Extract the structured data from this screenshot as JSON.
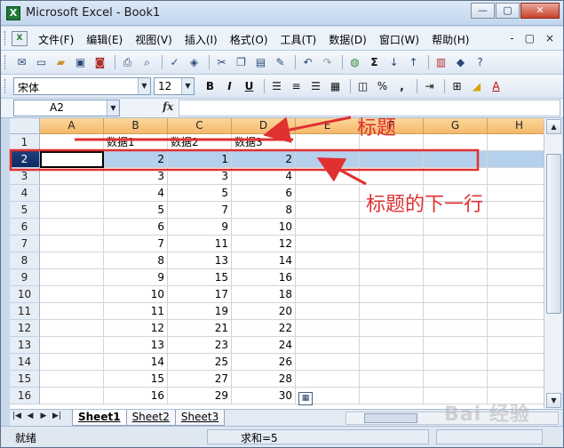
{
  "window": {
    "title": "Microsoft Excel - Book1",
    "buttons": {
      "minimize": "—",
      "restore": "▢",
      "close": "✕"
    }
  },
  "menubar": {
    "items": [
      "文件(F)",
      "编辑(E)",
      "视图(V)",
      "插入(I)",
      "格式(O)",
      "工具(T)",
      "数据(D)",
      "窗口(W)",
      "帮助(H)"
    ],
    "right_controls": [
      "-",
      "▢",
      "×"
    ]
  },
  "toolbar_standard": {
    "icons": [
      "mail-icon",
      "new-icon",
      "open-icon",
      "save-icon",
      "permission-icon",
      "print-icon",
      "print-preview-icon",
      "spelling-icon",
      "research-icon",
      "cut-icon",
      "copy-icon",
      "paste-icon",
      "format-painter-icon",
      "undo-icon",
      "redo-icon",
      "hyperlink-icon",
      "autosum-icon",
      "sort-asc-icon",
      "sort-desc-icon",
      "chart-icon",
      "drawing-icon",
      "help-icon"
    ]
  },
  "toolbar_format": {
    "font": "宋体",
    "size": "12",
    "bold": "B",
    "italic": "I",
    "underline": "U",
    "percent": "%",
    "comma": ","
  },
  "formula_bar": {
    "name_box": "A2",
    "fx": "fx",
    "value": ""
  },
  "grid": {
    "columns": [
      "A",
      "B",
      "C",
      "D",
      "E",
      "F",
      "G",
      "H"
    ],
    "rows": [
      {
        "num": "1",
        "cells": [
          "",
          "数据1",
          "数据2",
          "数据3",
          "",
          "",
          "",
          ""
        ]
      },
      {
        "num": "2",
        "cells": [
          "",
          "2",
          "1",
          "2",
          "",
          "",
          "",
          ""
        ]
      },
      {
        "num": "3",
        "cells": [
          "",
          "3",
          "3",
          "4",
          "",
          "",
          "",
          ""
        ]
      },
      {
        "num": "4",
        "cells": [
          "",
          "4",
          "5",
          "6",
          "",
          "",
          "",
          ""
        ]
      },
      {
        "num": "5",
        "cells": [
          "",
          "5",
          "7",
          "8",
          "",
          "",
          "",
          ""
        ]
      },
      {
        "num": "6",
        "cells": [
          "",
          "6",
          "9",
          "10",
          "",
          "",
          "",
          ""
        ]
      },
      {
        "num": "7",
        "cells": [
          "",
          "7",
          "11",
          "12",
          "",
          "",
          "",
          ""
        ]
      },
      {
        "num": "8",
        "cells": [
          "",
          "8",
          "13",
          "14",
          "",
          "",
          "",
          ""
        ]
      },
      {
        "num": "9",
        "cells": [
          "",
          "9",
          "15",
          "16",
          "",
          "",
          "",
          ""
        ]
      },
      {
        "num": "10",
        "cells": [
          "",
          "10",
          "17",
          "18",
          "",
          "",
          "",
          ""
        ]
      },
      {
        "num": "11",
        "cells": [
          "",
          "11",
          "19",
          "20",
          "",
          "",
          "",
          ""
        ]
      },
      {
        "num": "12",
        "cells": [
          "",
          "12",
          "21",
          "22",
          "",
          "",
          "",
          ""
        ]
      },
      {
        "num": "13",
        "cells": [
          "",
          "13",
          "23",
          "24",
          "",
          "",
          "",
          ""
        ]
      },
      {
        "num": "14",
        "cells": [
          "",
          "14",
          "25",
          "26",
          "",
          "",
          "",
          ""
        ]
      },
      {
        "num": "15",
        "cells": [
          "",
          "15",
          "27",
          "28",
          "",
          "",
          "",
          ""
        ]
      },
      {
        "num": "16",
        "cells": [
          "",
          "16",
          "29",
          "30",
          "",
          "",
          "",
          ""
        ]
      }
    ]
  },
  "sheets": [
    "Sheet1",
    "Sheet2",
    "Sheet3"
  ],
  "status": {
    "ready": "就绪",
    "sum": "求和=5"
  },
  "annotations": {
    "header_label": "标题",
    "next_row_label": "标题的下一行"
  },
  "watermark": "Bai 经验",
  "colors": {
    "annotation": "#e03030",
    "column_header": "#f5b869",
    "selected_row": "#b5d0ec"
  }
}
